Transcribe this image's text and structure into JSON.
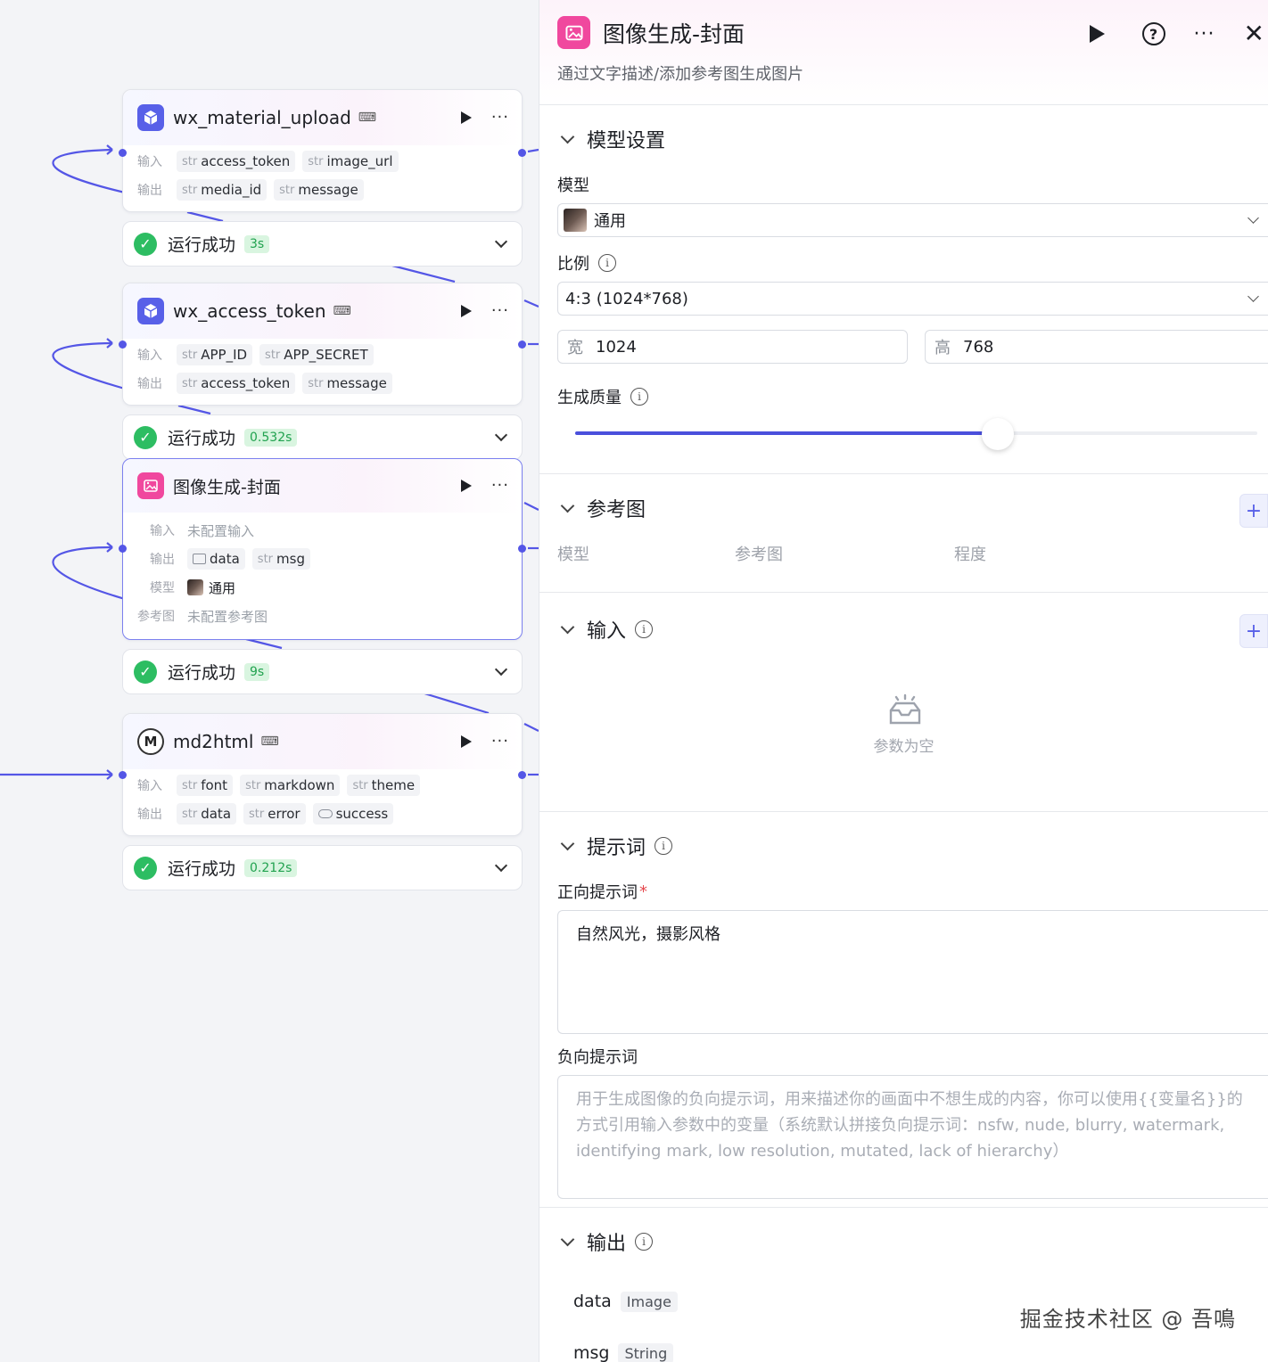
{
  "colors": {
    "accent": "#5860e8",
    "edge": "#5456e6",
    "success": "#2dbd62",
    "image_node": "#f0489e"
  },
  "nodes": [
    {
      "title": "wx_material_upload",
      "icon": "cube-icon",
      "inputs_label": "输入",
      "outputs_label": "输出",
      "inputs": [
        {
          "type": "str",
          "name": "access_token"
        },
        {
          "type": "str",
          "name": "image_url"
        }
      ],
      "outputs": [
        {
          "type": "str",
          "name": "media_id"
        },
        {
          "type": "str",
          "name": "message"
        }
      ],
      "status": "运行成功",
      "time": "3s"
    },
    {
      "title": "wx_access_token",
      "icon": "cube-icon",
      "inputs_label": "输入",
      "outputs_label": "输出",
      "inputs": [
        {
          "type": "str",
          "name": "APP_ID"
        },
        {
          "type": "str",
          "name": "APP_SECRET"
        }
      ],
      "outputs": [
        {
          "type": "str",
          "name": "access_token"
        },
        {
          "type": "str",
          "name": "message"
        }
      ],
      "status": "运行成功",
      "time": "0.532s"
    },
    {
      "title": "图像生成-封面",
      "icon": "image-gen-icon",
      "inputs_label": "输入",
      "inputs_value": "未配置输入",
      "outputs_label": "输出",
      "outputs": [
        {
          "type": "image",
          "name": "data"
        },
        {
          "type": "str",
          "name": "msg"
        }
      ],
      "model_label": "模型",
      "model_value": "通用",
      "ref_label": "参考图",
      "ref_value": "未配置参考图",
      "status": "运行成功",
      "time": "9s"
    },
    {
      "title": "md2html",
      "icon": "m-logo-icon",
      "inputs_label": "输入",
      "outputs_label": "输出",
      "inputs": [
        {
          "type": "str",
          "name": "font"
        },
        {
          "type": "str",
          "name": "markdown"
        },
        {
          "type": "str",
          "name": "theme"
        }
      ],
      "outputs": [
        {
          "type": "str",
          "name": "data"
        },
        {
          "type": "str",
          "name": "error"
        },
        {
          "type": "bool",
          "name": "success"
        }
      ],
      "status": "运行成功",
      "time": "0.212s"
    }
  ],
  "panel": {
    "title": "图像生成-封面",
    "description": "通过文字描述/添加参考图生成图片",
    "model_section": {
      "title": "模型设置",
      "model_label": "模型",
      "model_value": "通用",
      "ratio_label": "比例",
      "ratio_value": "4:3 (1024*768)",
      "width_prefix": "宽",
      "width_value": "1024",
      "height_prefix": "高",
      "height_value": "768",
      "quality_label": "生成质量",
      "quality_level": 0.62
    },
    "ref_section": {
      "title": "参考图",
      "columns": [
        "模型",
        "参考图",
        "程度"
      ]
    },
    "input_section": {
      "title": "输入",
      "empty_text": "参数为空"
    },
    "prompt_section": {
      "title": "提示词",
      "positive_label": "正向提示词",
      "required_mark": "*",
      "positive_value": "自然风光，摄影风格",
      "negative_label": "负向提示词",
      "negative_placeholder": "用于生成图像的负向提示词，用来描述你的画面中不想生成的内容，你可以使用{{变量名}}的方式引用输入参数中的变量（系统默认拼接负向提示词：nsfw, nude, blurry, watermark, identifying mark, low resolution, mutated, lack of hierarchy）"
    },
    "output_section": {
      "title": "输出",
      "items": [
        {
          "name": "data",
          "type": "Image"
        },
        {
          "name": "msg",
          "type": "String"
        }
      ]
    }
  },
  "watermark": "掘金技术社区 @ 吾鳴"
}
